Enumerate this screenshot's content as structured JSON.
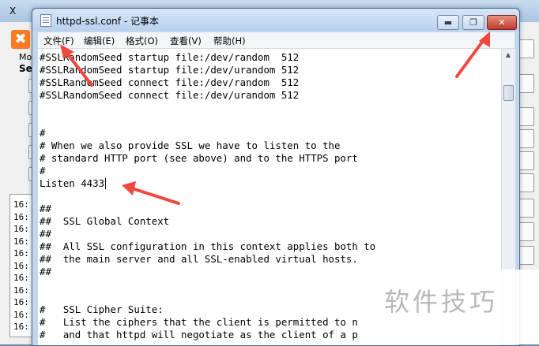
{
  "background_app": {
    "title_fragment": "X",
    "logo_glyph": "✖",
    "modules_label": "Mo",
    "service_label": "Ser",
    "log_lines": [
      "16:",
      "16:",
      "16:",
      "16:",
      "16:",
      "16:",
      "16:",
      "16:",
      "16:",
      "16:",
      "16:"
    ]
  },
  "window": {
    "title": "httpd-ssl.conf - 记事本",
    "minimize_glyph": "▬",
    "maximize_glyph": "❐",
    "close_glyph": "✕"
  },
  "menu": {
    "file": "文件(F)",
    "edit": "编辑(E)",
    "format": "格式(O)",
    "view": "查看(V)",
    "help": "帮助(H)"
  },
  "editor": {
    "lines": [
      "#SSLRandomSeed startup file:/dev/random  512",
      "#SSLRandomSeed startup file:/dev/urandom 512",
      "#SSLRandomSeed connect file:/dev/random  512",
      "#SSLRandomSeed connect file:/dev/urandom 512",
      "",
      "",
      "#",
      "# When we also provide SSL we have to listen to the",
      "# standard HTTP port (see above) and to the HTTPS port",
      "#",
      "Listen 4433",
      "",
      "##",
      "##  SSL Global Context",
      "##",
      "##  All SSL configuration in this context applies both to",
      "##  the main server and all SSL-enabled virtual hosts.",
      "##",
      "",
      "",
      "#   SSL Cipher Suite:",
      "#   List the ciphers that the client is permitted to n",
      "#   and that httpd will negotiate as the client of a p"
    ],
    "caret_line": 10
  },
  "scrollbar": {
    "up_glyph": "▲"
  },
  "watermark": {
    "text": "软件技巧"
  },
  "colors": {
    "arrow": "#f0483e",
    "close_button": "#c0392b"
  }
}
